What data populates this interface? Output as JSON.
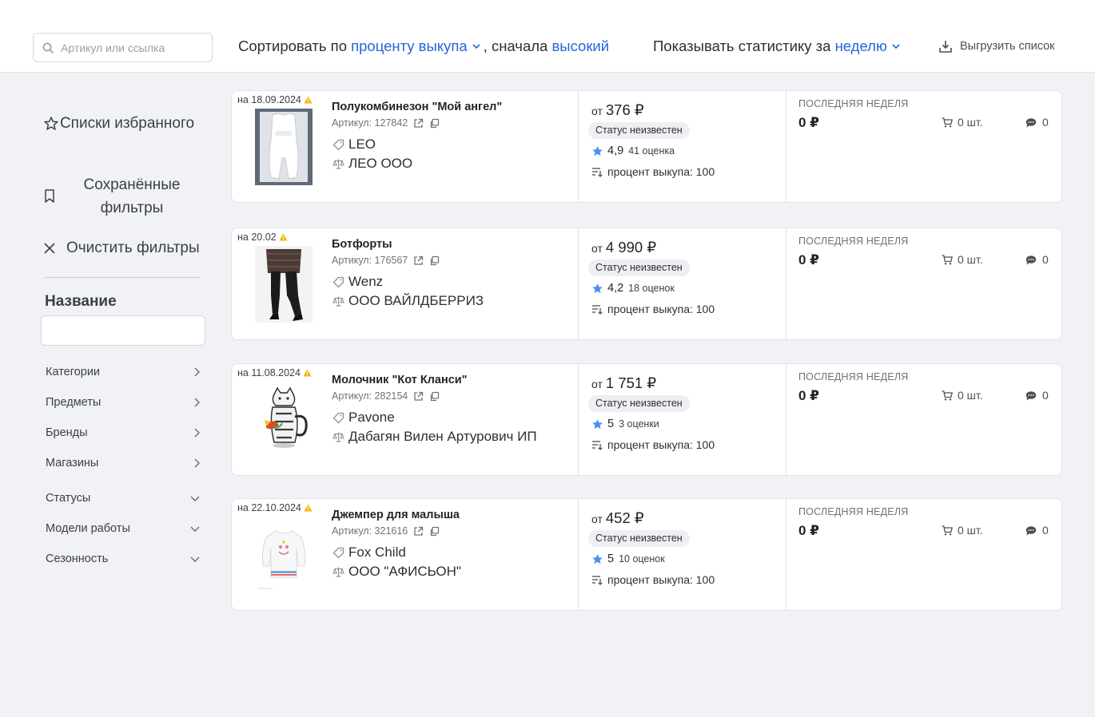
{
  "header": {
    "search_placeholder": "Артикул или ссылка",
    "sort_prefix": "Сортировать по",
    "sort_field": "проценту выкупа",
    "sort_middle": ", сначала",
    "sort_order": "высокий",
    "stats_prefix": "Показывать статистику за",
    "stats_period": "неделю",
    "export_label": "Выгрузить список"
  },
  "sidebar": {
    "favorites_label": "Списки избранного",
    "saved_filters_label": "Сохранённые фильтры",
    "clear_filters_label": "Очистить фильтры",
    "name_title": "Название",
    "name_value": "",
    "filters": [
      {
        "label": "Категории",
        "state": "collapsed"
      },
      {
        "label": "Предметы",
        "state": "collapsed"
      },
      {
        "label": "Бренды",
        "state": "collapsed"
      },
      {
        "label": "Магазины",
        "state": "collapsed"
      },
      {
        "label": "Статусы",
        "state": "expandable"
      },
      {
        "label": "Модели работы",
        "state": "expandable"
      },
      {
        "label": "Сезонность",
        "state": "expandable"
      }
    ]
  },
  "products": [
    {
      "date": "на 18.09.2024",
      "name": "Полукомбинезон \"Мой ангел\"",
      "article": "Артикул: 127842",
      "brand": "LEO",
      "seller": "ЛЕО ООО",
      "price_prefix": "от",
      "price": "376 ₽",
      "status": "Статус неизвестен",
      "rating": "4,9",
      "rating_count": "41 оценка",
      "buyout": "процент выкупа: 100",
      "period_label": "ПОСЛЕДНЯЯ НЕДЕЛЯ",
      "revenue": "0 ₽",
      "qty": "0 шт.",
      "feedbacks": "0",
      "image": "white-romper"
    },
    {
      "date": "на 20.02",
      "name": "Ботфорты",
      "article": "Артикул: 176567",
      "brand": "Wenz",
      "seller": "ООО ВАЙЛДБЕРРИЗ",
      "price_prefix": "от",
      "price": "4 990 ₽",
      "status": "Статус неизвестен",
      "rating": "4,2",
      "rating_count": "18 оценок",
      "buyout": "процент выкупа: 100",
      "period_label": "ПОСЛЕДНЯЯ НЕДЕЛЯ",
      "revenue": "0 ₽",
      "qty": "0 шт.",
      "feedbacks": "0",
      "image": "black-boots"
    },
    {
      "date": "на 11.08.2024",
      "name": "Молочник \"Кот Кланси\"",
      "article": "Артикул: 282154",
      "brand": "Pavone",
      "seller": "Дабагян Вилен Артурович ИП",
      "price_prefix": "от",
      "price": "1 751 ₽",
      "status": "Статус неизвестен",
      "rating": "5",
      "rating_count": "3 оценки",
      "buyout": "процент выкупа: 100",
      "period_label": "ПОСЛЕДНЯЯ НЕДЕЛЯ",
      "revenue": "0 ₽",
      "qty": "0 шт.",
      "feedbacks": "0",
      "image": "cat-creamer"
    },
    {
      "date": "на 22.10.2024",
      "name": "Джемпер для малыша",
      "article": "Артикул: 321616",
      "brand": "Fox Child",
      "seller": "ООО \"АФИСЬОН\"",
      "price_prefix": "от",
      "price": "452 ₽",
      "status": "Статус неизвестен",
      "rating": "5",
      "rating_count": "10 оценок",
      "buyout": "процент выкупа: 100",
      "period_label": "ПОСЛЕДНЯЯ НЕДЕЛЯ",
      "revenue": "0 ₽",
      "qty": "0 шт.",
      "feedbacks": "0",
      "image": "kids-sweater"
    }
  ],
  "colors": {
    "accent": "#2467d8",
    "star": "#4a8ff0",
    "warning": "#f5b400",
    "background": "#f1f2f5"
  }
}
